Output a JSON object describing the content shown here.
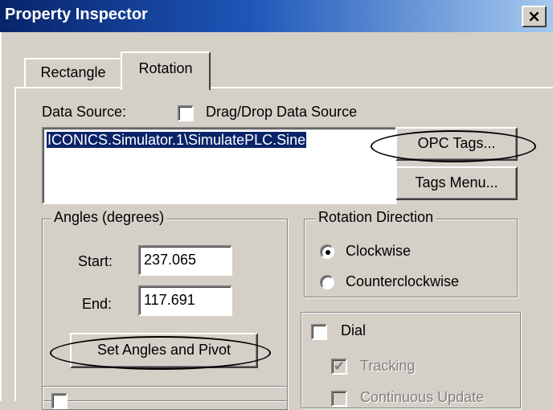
{
  "window": {
    "title": "Property Inspector",
    "close_glyph": "×"
  },
  "tabs": [
    {
      "label": "Rectangle"
    },
    {
      "label": "Rotation"
    }
  ],
  "data_source": {
    "label": "Data Source:",
    "drag_drop_label": "Drag/Drop Data Source",
    "value": "ICONICS.Simulator.1\\SimulatePLC.Sine",
    "opc_tags_button": "OPC Tags...",
    "tags_menu_button": "Tags Menu..."
  },
  "angles": {
    "title": "Angles (degrees)",
    "start_label": "Start:",
    "start_value": "237.065",
    "end_label": "End:",
    "end_value": "117.691",
    "set_button": "Set Angles and Pivot"
  },
  "rotation_direction": {
    "title": "Rotation Direction",
    "options": [
      "Clockwise",
      "Counterclockwise"
    ],
    "selected": "Clockwise"
  },
  "dial": {
    "label": "Dial",
    "tracking_label": "Tracking",
    "continuous_label": "Continuous Update"
  },
  "colors": {
    "title_start": "#08246b",
    "title_end": "#a6caf0",
    "face": "#d4d0c8",
    "selection": "#0a246a"
  }
}
